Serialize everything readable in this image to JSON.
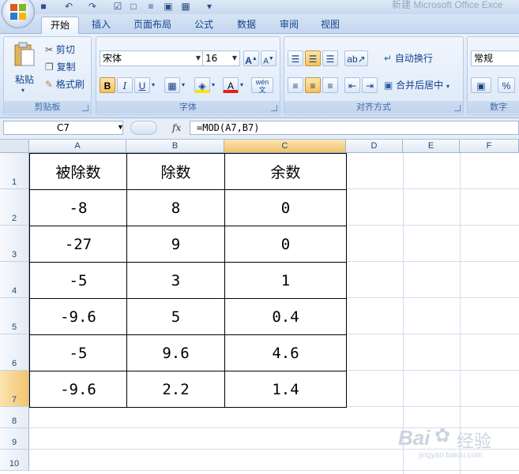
{
  "window": {
    "title": "新建 Microsoft Office Exce"
  },
  "tabs": [
    {
      "label": "开始",
      "active": true
    },
    {
      "label": "插入"
    },
    {
      "label": "页面布局"
    },
    {
      "label": "公式"
    },
    {
      "label": "数据"
    },
    {
      "label": "审阅"
    },
    {
      "label": "视图"
    }
  ],
  "ribbon": {
    "clipboard": {
      "label": "剪贴板",
      "paste": "粘贴",
      "cut": "剪切",
      "copy": "复制",
      "format_painter": "格式刷"
    },
    "font": {
      "label": "字体",
      "font_name": "宋体",
      "font_size": "16",
      "bold": "B",
      "italic": "I",
      "underline": "U",
      "phonetic": "wén"
    },
    "alignment": {
      "label": "对齐方式",
      "wrap_text": "自动换行",
      "merge_center": "合并后居中"
    },
    "number": {
      "label": "数字",
      "format": "常规",
      "percent": "%"
    }
  },
  "formula_bar": {
    "name_box": "C7",
    "fx": "fx",
    "formula": "=MOD(A7,B7)"
  },
  "grid": {
    "columns": [
      "A",
      "B",
      "C",
      "D",
      "E",
      "F"
    ],
    "rows": [
      "1",
      "2",
      "3",
      "4",
      "5",
      "6",
      "7",
      "8",
      "9",
      "10"
    ],
    "selected_cell": "C7",
    "table": {
      "header": [
        "被除数",
        "除数",
        "余数"
      ],
      "rows": [
        [
          "-8",
          "8",
          "0"
        ],
        [
          "-27",
          "9",
          "0"
        ],
        [
          "-5",
          "3",
          "1"
        ],
        [
          "-9.6",
          "5",
          "0.4"
        ],
        [
          "-5",
          "9.6",
          "4.6"
        ],
        [
          "-9.6",
          "2.2",
          "1.4"
        ]
      ]
    }
  },
  "watermark": {
    "brand": "Bai",
    "cn": "经验",
    "url": "jingyan.baidu.com"
  },
  "colors": {
    "accent": "#15428b",
    "selected_header": "#f2c46f",
    "ribbon_bg": "#dbe8f7"
  }
}
